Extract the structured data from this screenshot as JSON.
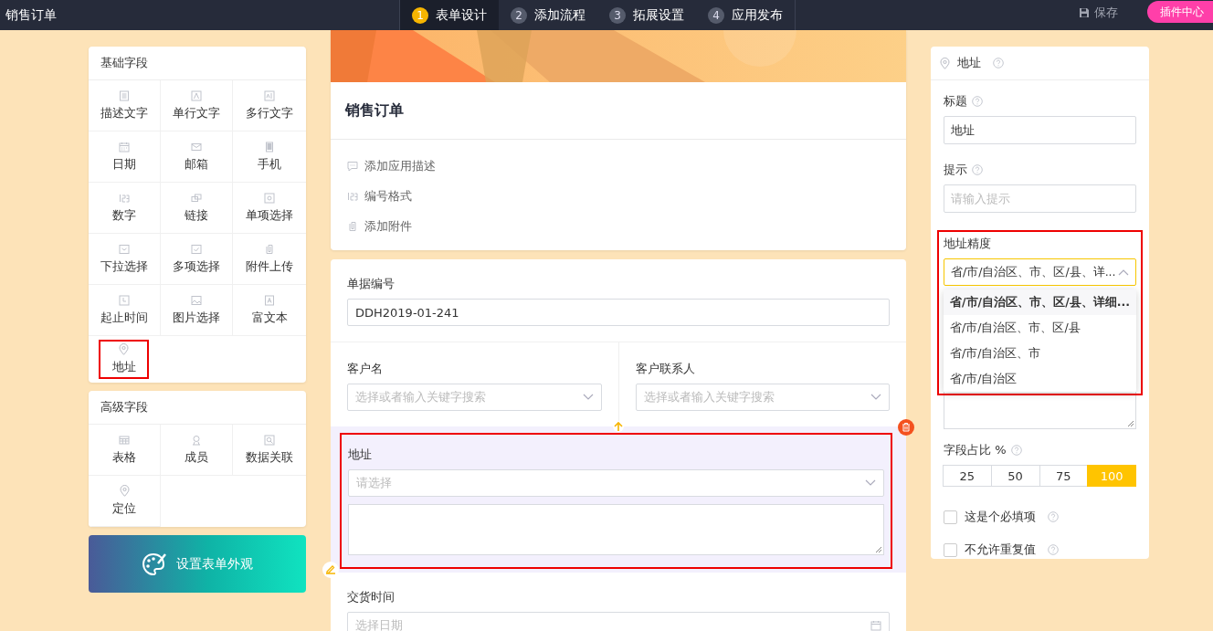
{
  "app_title": "销售订单",
  "steps": [
    {
      "number": "1",
      "label": "表单设计",
      "selected": true
    },
    {
      "number": "2",
      "label": "添加流程",
      "selected": false
    },
    {
      "number": "3",
      "label": "拓展设置",
      "selected": false
    },
    {
      "number": "4",
      "label": "应用发布",
      "selected": false
    }
  ],
  "save_button": "保存",
  "plugin_button": "插件中心",
  "palette": {
    "groups": [
      {
        "title": "基础字段",
        "items": [
          {
            "label": "描述文字",
            "highlighted": false
          },
          {
            "label": "单行文字",
            "highlighted": false
          },
          {
            "label": "多行文字",
            "highlighted": false
          },
          {
            "label": "日期",
            "highlighted": false
          },
          {
            "label": "邮箱",
            "highlighted": false
          },
          {
            "label": "手机",
            "highlighted": false
          },
          {
            "label": "数字",
            "highlighted": false
          },
          {
            "label": "链接",
            "highlighted": false
          },
          {
            "label": "单项选择",
            "highlighted": false
          },
          {
            "label": "下拉选择",
            "highlighted": false
          },
          {
            "label": "多项选择",
            "highlighted": false
          },
          {
            "label": "附件上传",
            "highlighted": false
          },
          {
            "label": "起止时间",
            "highlighted": false
          },
          {
            "label": "图片选择",
            "highlighted": false
          },
          {
            "label": "富文本",
            "highlighted": false
          },
          {
            "label": "地址",
            "highlighted": true
          }
        ]
      },
      {
        "title": "高级字段",
        "items": [
          {
            "label": "表格",
            "highlighted": false
          },
          {
            "label": "成员",
            "highlighted": false
          },
          {
            "label": "数据关联",
            "highlighted": false
          },
          {
            "label": "定位",
            "highlighted": false
          }
        ]
      }
    ],
    "appearance_button": "设置表单外观"
  },
  "form": {
    "title": "销售订单",
    "actions": [
      "添加应用描述",
      "编号格式",
      "添加附件"
    ],
    "fields": [
      {
        "kind": "text",
        "label": "单据编号",
        "value": "DDH2019-01-241"
      },
      {
        "kind": "pair",
        "columns": [
          {
            "label": "客户名",
            "placeholder": "选择或者输入关键字搜索"
          },
          {
            "label": "客户联系人",
            "placeholder": "选择或者输入关键字搜索"
          }
        ]
      },
      {
        "kind": "address",
        "label": "地址",
        "placeholder": "请选择",
        "selected": true,
        "highlighted": true
      },
      {
        "kind": "date",
        "label": "交货时间",
        "placeholder": "选择日期"
      }
    ]
  },
  "props": {
    "title": "地址",
    "title_label": "标题",
    "title_value": "地址",
    "hint_label": "提示",
    "hint_placeholder": "请输入提示",
    "precision": {
      "label": "地址精度",
      "value": "省/市/自治区、市、区/县、详...",
      "expanded": true,
      "highlighted": true,
      "options": [
        {
          "label": "省/市/自治区、市、区/县、详细...",
          "selected": true
        },
        {
          "label": "省/市/自治区、市、区/县",
          "selected": false
        },
        {
          "label": "省/市/自治区、市",
          "selected": false
        },
        {
          "label": "省/市/自治区",
          "selected": false
        }
      ]
    },
    "width": {
      "label": "字段占比 %",
      "options": [
        {
          "label": "25",
          "selected": false
        },
        {
          "label": "50",
          "selected": false
        },
        {
          "label": "75",
          "selected": false
        },
        {
          "label": "100",
          "selected": true
        }
      ]
    },
    "checkboxes": [
      {
        "label": "这是个必填项",
        "checked": false
      },
      {
        "label": "不允许重复值",
        "checked": false
      }
    ]
  }
}
